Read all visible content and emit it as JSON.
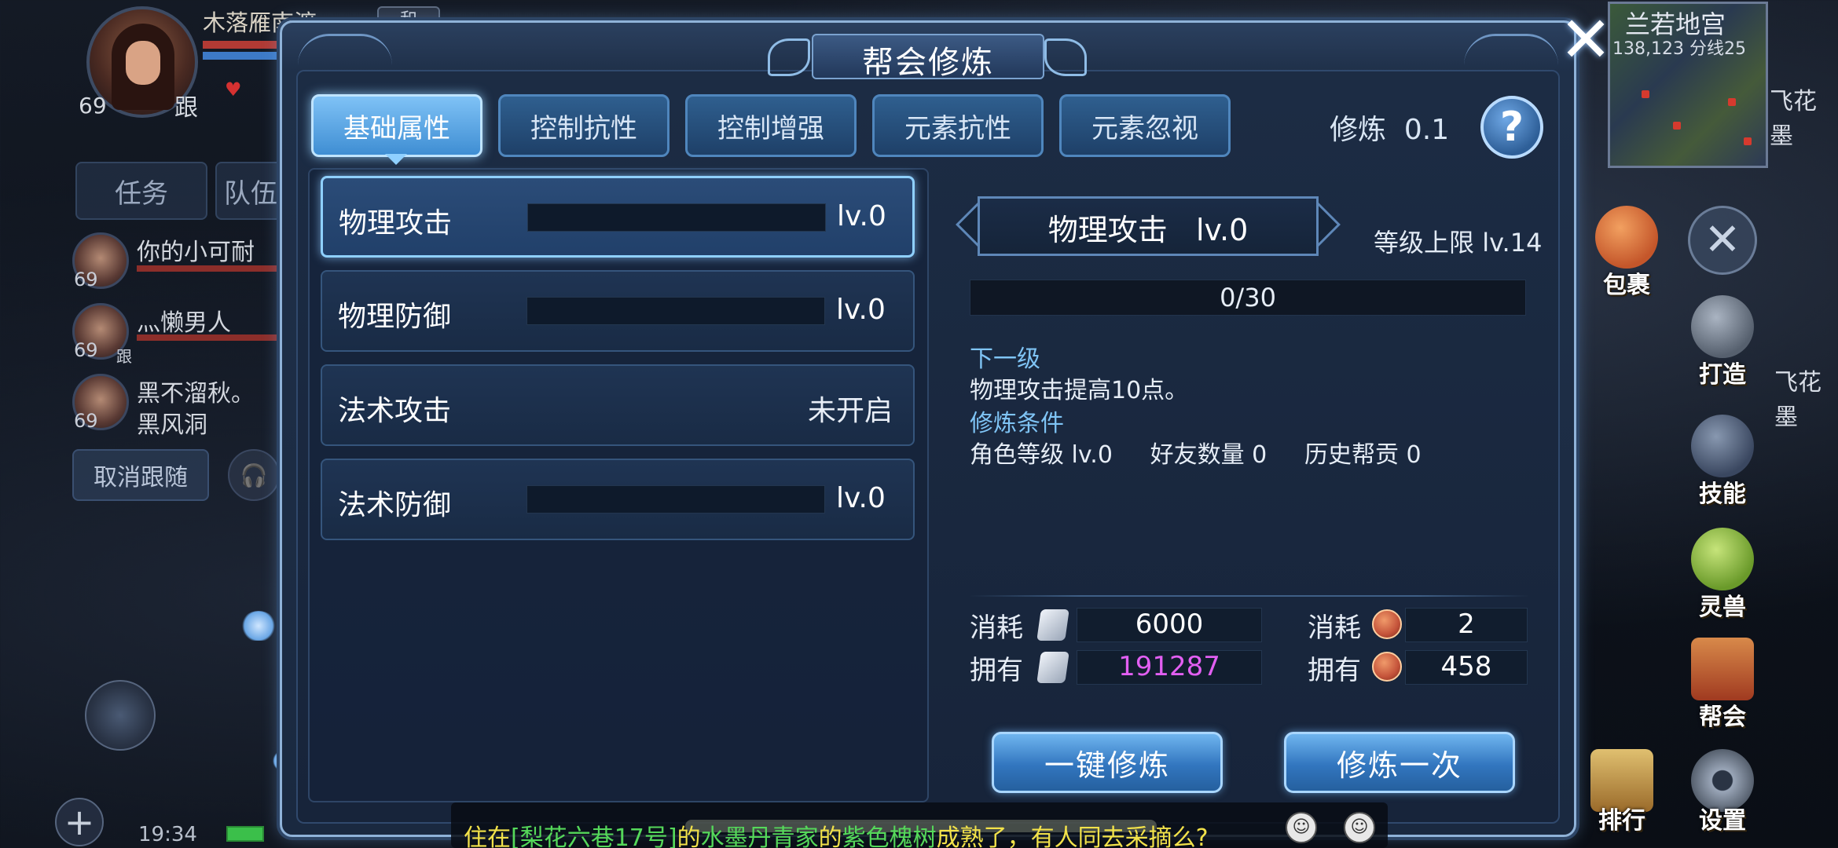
{
  "player": {
    "name": "木落雁南渡",
    "badge": "和",
    "level": "69",
    "follow": "跟"
  },
  "hud_tabs": [
    "任务",
    "队伍"
  ],
  "team": [
    {
      "name": "你的小可耐",
      "level": "69",
      "tag": ""
    },
    {
      "name": "灬懒男人",
      "level": "69",
      "tag": "跟"
    },
    {
      "name": "黑不溜秋。",
      "sub": "黑风洞",
      "level": "69",
      "tag": ""
    }
  ],
  "cancel_follow": "取消跟随",
  "status_bar": {
    "time": "19:34"
  },
  "minimap": {
    "name": "兰若地宫",
    "coords": "138,123 分线25",
    "side_label_1": "飞花墨",
    "side_label_2": "飞花墨"
  },
  "right_menu": [
    {
      "label": "包裹",
      "icon": "bag-icon",
      "color": "#d9742f"
    },
    {
      "label": "打造",
      "icon": "hammer-icon",
      "color": "#7c8796"
    },
    {
      "label": "技能",
      "icon": "book-icon",
      "color": "#5a6a84"
    },
    {
      "label": "灵兽",
      "icon": "spirit-pet-icon",
      "color": "#8ec34a"
    },
    {
      "label": "帮会",
      "icon": "scroll-icon",
      "color": "#c2562c"
    },
    {
      "label": "排行",
      "icon": "rank-icon",
      "color": "#c9a34a"
    },
    {
      "label": "设置",
      "icon": "gear-icon",
      "color": "#7d8a9c"
    }
  ],
  "modal": {
    "title": "帮会修炼",
    "tabs": [
      "基础属性",
      "控制抗性",
      "控制增强",
      "元素抗性",
      "元素忽视"
    ],
    "active_tab": 0,
    "cultivate_label": "修炼",
    "cultivate_value": "0.1",
    "help": "?",
    "close": "✕",
    "attributes": [
      {
        "name": "物理攻击",
        "level": "lv.0",
        "progress": 0,
        "locked": false
      },
      {
        "name": "物理防御",
        "level": "lv.0",
        "progress": 0,
        "locked": false
      },
      {
        "name": "法术攻击",
        "level": "",
        "locked": true,
        "locked_text": "未开启"
      },
      {
        "name": "法术防御",
        "level": "lv.0",
        "progress": 0,
        "locked": false
      }
    ],
    "detail": {
      "title": "物理攻击",
      "level": "lv.0",
      "level_cap_label": "等级上限",
      "level_cap": "lv.14",
      "exp": "0/30",
      "exp_progress": 0,
      "next_level_label": "下一级",
      "next_level_text": "物理攻击提高10点。",
      "condition_label": "修炼条件",
      "conditions": [
        {
          "label": "角色等级",
          "value": "lv.0"
        },
        {
          "label": "好友数量",
          "value": "0"
        },
        {
          "label": "历史帮贡",
          "value": "0"
        }
      ]
    },
    "costs": {
      "consume_label": "消耗",
      "own_label": "拥有",
      "silver_consume": "6000",
      "silver_own": "191287",
      "coin_consume": "2",
      "coin_own": "458",
      "silver_own_color": "#e25ff2"
    },
    "buttons": {
      "one_click": "一键修炼",
      "once": "修炼一次"
    }
  },
  "chat": {
    "prefix": "住在",
    "location": "[梨花六巷17号]",
    "mid1": "的",
    "person": "水墨丹青家",
    "mid2": "的",
    "item": "紫色槐树",
    "suffix": "成熟了，有人同去采摘么?",
    "colors": {
      "normal": "#f2e24a",
      "highlight": "#55d85a"
    }
  },
  "colors": {
    "accent": "#8fd0ff",
    "panel": "#1a2940",
    "section_label": "#7fc4f5"
  }
}
